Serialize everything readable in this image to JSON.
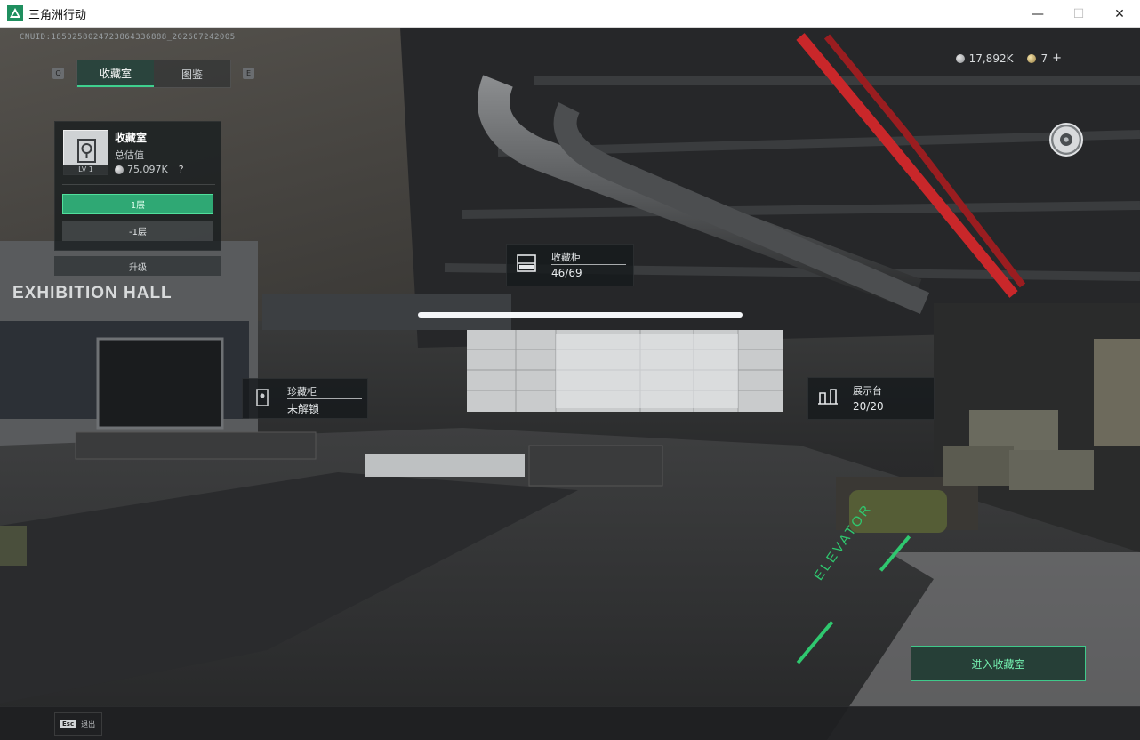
{
  "window": {
    "title": "三角洲行动",
    "controls": {
      "minimize": "—",
      "maximize": "☐",
      "close": "✕"
    }
  },
  "uid": "CNUID:1850258024723864336888_202607242005",
  "tabs": {
    "left_key": "Q",
    "right_key": "E",
    "items": [
      {
        "label": "收藏室",
        "active": true
      },
      {
        "label": "图鉴",
        "active": false
      }
    ]
  },
  "room": {
    "name": "收藏室",
    "level": "LV 1",
    "value_label": "总估值",
    "value": "75,097K",
    "help": "?",
    "floors": [
      {
        "label": "1层",
        "selected": true
      },
      {
        "label": "-1层",
        "selected": false
      }
    ],
    "upgrade": "升级"
  },
  "currency": {
    "silver": "17,892K",
    "gold": "7",
    "add": "+"
  },
  "scene_tags": {
    "cabinet": {
      "title": "收藏柜",
      "value": "46/69",
      "icon": "cabinet-icon"
    },
    "treasure": {
      "title": "珍藏柜",
      "value": "未解锁",
      "icon": "locked-treasure-icon"
    },
    "display": {
      "title": "展示台",
      "value": "20/20",
      "icon": "display-stand-icon"
    }
  },
  "scene_text": {
    "hall_sign": "EXHIBITION HALL",
    "floor_marking": "ELEVATOR"
  },
  "enter_button": "进入收藏室",
  "esc": {
    "key": "Esc",
    "label": "退出"
  },
  "colors": {
    "accent_green": "#3fd08e",
    "floor_selected": "#2fa874",
    "pipe_red": "#c9272a"
  }
}
